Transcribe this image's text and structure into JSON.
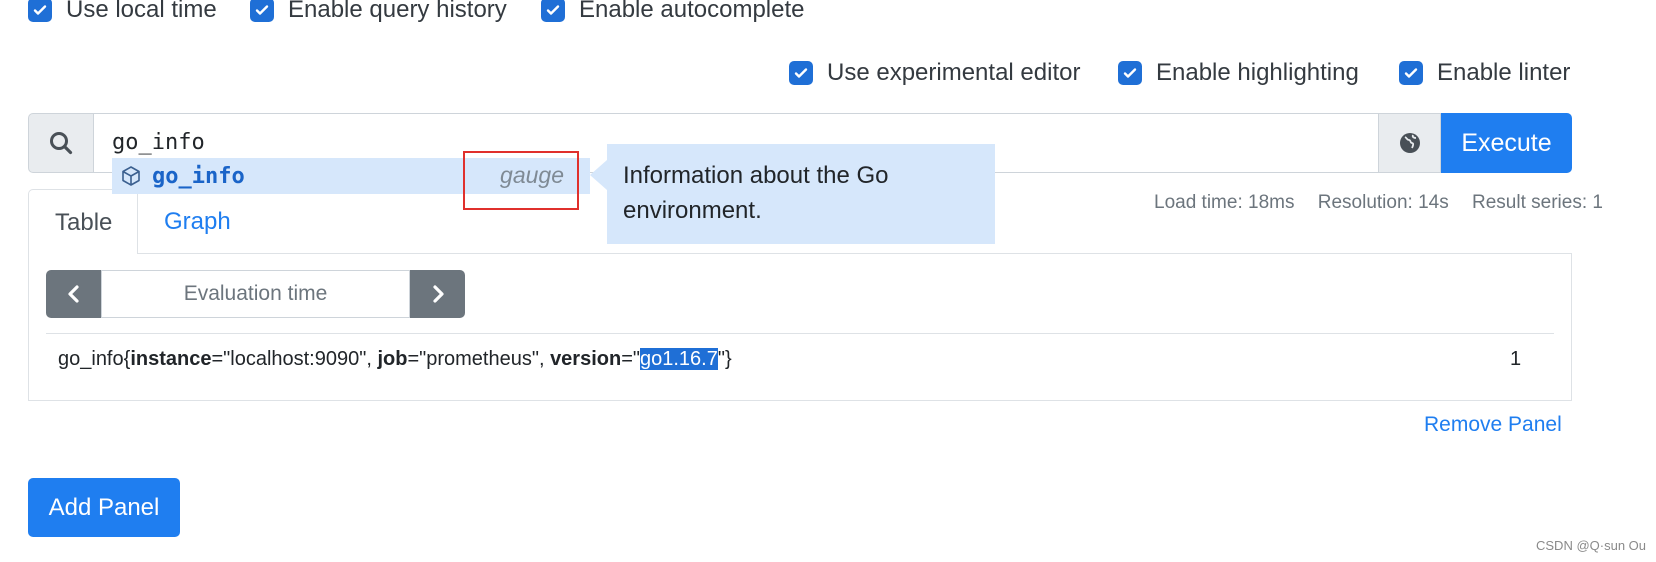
{
  "options_row1": [
    {
      "label": "Use local time",
      "checked": true
    },
    {
      "label": "Enable query history",
      "checked": true
    },
    {
      "label": "Enable autocomplete",
      "checked": true
    }
  ],
  "options_row2": [
    {
      "label": "Use experimental editor",
      "checked": true
    },
    {
      "label": "Enable highlighting",
      "checked": true
    },
    {
      "label": "Enable linter",
      "checked": true
    }
  ],
  "query": {
    "value": "go_info",
    "execute_label": "Execute"
  },
  "autocomplete": {
    "label": "go_info",
    "type": "gauge",
    "info": "Information about the Go environment."
  },
  "tabs": {
    "table": "Table",
    "graph": "Graph"
  },
  "stats": {
    "load_time": "Load time: 18ms",
    "resolution": "Resolution: 14s",
    "result_series": "Result series: 1"
  },
  "evaluation": {
    "placeholder": "Evaluation time"
  },
  "result": {
    "metric": "go_info",
    "open": "{",
    "label1_key": "instance",
    "label1_val": "=\"localhost:9090\", ",
    "label2_key": "job",
    "label2_val": "=\"prometheus\", ",
    "label3_key": "version",
    "label3_eq": "=\"",
    "label3_val_selected": "go1.16.7",
    "close": "\"}",
    "value": "1"
  },
  "remove_panel_label": "Remove Panel",
  "add_panel_label": "Add Panel",
  "watermark": "CSDN @Q·sun Ou",
  "colors": {
    "primary": "#1f7ef0",
    "checkbox": "#1f6fd6",
    "autocomplete_bg": "#d6e7fb",
    "annotation_box": "#e0302c"
  }
}
